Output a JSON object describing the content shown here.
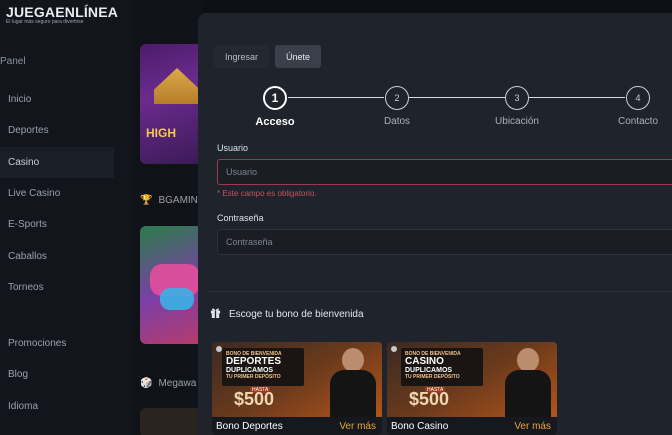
{
  "logo": {
    "main": "JUEGAENLÍNEA",
    "sub": "El lugar más seguro para divertirse"
  },
  "sidebar": {
    "panel_label": "Panel",
    "items": [
      {
        "label": "Inicio"
      },
      {
        "label": "Deportes"
      },
      {
        "label": "Casino"
      },
      {
        "label": "Live Casino"
      },
      {
        "label": "E-Sports"
      },
      {
        "label": "Caballos"
      },
      {
        "label": "Torneos"
      }
    ],
    "items2": [
      {
        "label": "Promociones"
      },
      {
        "label": "Blog"
      },
      {
        "label": "Idioma"
      }
    ]
  },
  "background": {
    "section1": "BGAMIN",
    "section2": "Megawa",
    "tile1_text": "HIGH"
  },
  "modal": {
    "tabs": [
      {
        "label": "Ingresar"
      },
      {
        "label": "Únete"
      }
    ],
    "steps": [
      {
        "number": "1",
        "label": "Acceso"
      },
      {
        "number": "2",
        "label": "Datos"
      },
      {
        "number": "3",
        "label": "Ubicación"
      },
      {
        "number": "4",
        "label": "Contacto"
      }
    ],
    "usuario_label": "Usuario",
    "usuario_placeholder": "Usuario",
    "usuario_error": "* Este campo es obligatorio.",
    "password_label": "Contraseña",
    "password_placeholder": "Contraseña",
    "bonus_title": "Escoge tu bono de bienvenida",
    "bonus_cards": [
      {
        "name": "Bono Deportes",
        "more": "Ver más",
        "banner_small": "BONO DE BIENVENIDA",
        "banner_big": "DEPORTES",
        "banner_mid": "DUPLICAMOS",
        "banner_sub": "TU PRIMER DEPÓSITO",
        "hasta": "HASTA",
        "amount": "$500"
      },
      {
        "name": "Bono Casino",
        "more": "Ver más",
        "banner_small": "BONO DE BIENVENIDA",
        "banner_big": "CASINO",
        "banner_mid": "DUPLICAMOS",
        "banner_sub": "TU PRIMER DEPÓSITO",
        "hasta": "HASTA",
        "amount": "$500"
      }
    ]
  },
  "colors": {
    "accent": "#e9a33a",
    "error": "#c4525f",
    "modal_bg": "#1f232b"
  }
}
